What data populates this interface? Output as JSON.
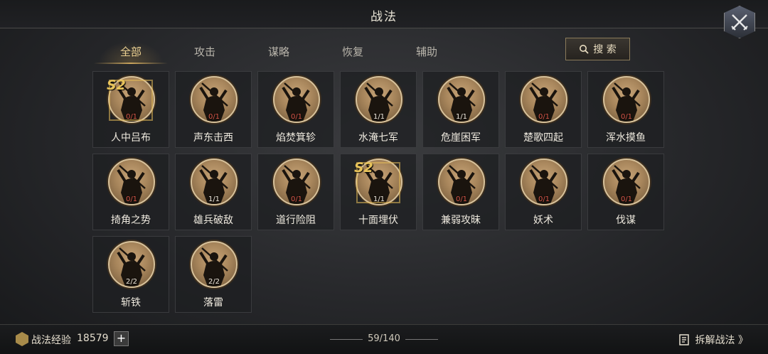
{
  "header": {
    "title": "战法"
  },
  "tabs": [
    {
      "label": "全部",
      "active": true
    },
    {
      "label": "攻击",
      "active": false
    },
    {
      "label": "谋略",
      "active": false
    },
    {
      "label": "恢复",
      "active": false
    },
    {
      "label": "辅助",
      "active": false
    }
  ],
  "search": {
    "label": "搜 索"
  },
  "cards": [
    {
      "name": "人中吕布",
      "count": "0/1",
      "rank": "S2"
    },
    {
      "name": "声东击西",
      "count": "0/1",
      "rank": ""
    },
    {
      "name": "焰焚箕轸",
      "count": "0/1",
      "rank": ""
    },
    {
      "name": "水淹七军",
      "count": "1/1",
      "rank": ""
    },
    {
      "name": "危崖困军",
      "count": "1/1",
      "rank": ""
    },
    {
      "name": "楚歌四起",
      "count": "0/1",
      "rank": ""
    },
    {
      "name": "浑水摸鱼",
      "count": "0/1",
      "rank": ""
    },
    {
      "name": "掎角之势",
      "count": "0/1",
      "rank": ""
    },
    {
      "name": "雄兵破敌",
      "count": "1/1",
      "rank": ""
    },
    {
      "name": "道行险阻",
      "count": "0/1",
      "rank": ""
    },
    {
      "name": "十面埋伏",
      "count": "1/1",
      "rank": "S2"
    },
    {
      "name": "兼弱攻昧",
      "count": "0/1",
      "rank": ""
    },
    {
      "name": "妖术",
      "count": "0/1",
      "rank": ""
    },
    {
      "name": "伐谋",
      "count": "0/1",
      "rank": ""
    },
    {
      "name": "斩铁",
      "count": "2/2",
      "rank": ""
    },
    {
      "name": "落雷",
      "count": "2/2",
      "rank": ""
    }
  ],
  "footer": {
    "exp_label": "战法经验",
    "exp_value": "18579",
    "plus": "+",
    "page": "59/140",
    "decompose_label": "拆解战法 》"
  },
  "icons": {
    "close": "crossed-swords-icon",
    "search": "magnifier-icon",
    "exp": "hexagon-icon",
    "decompose": "list-icon"
  },
  "colors": {
    "accent": "#c9a45c",
    "zero_count": "#d9584a",
    "active_tab": "#f0d79a"
  }
}
